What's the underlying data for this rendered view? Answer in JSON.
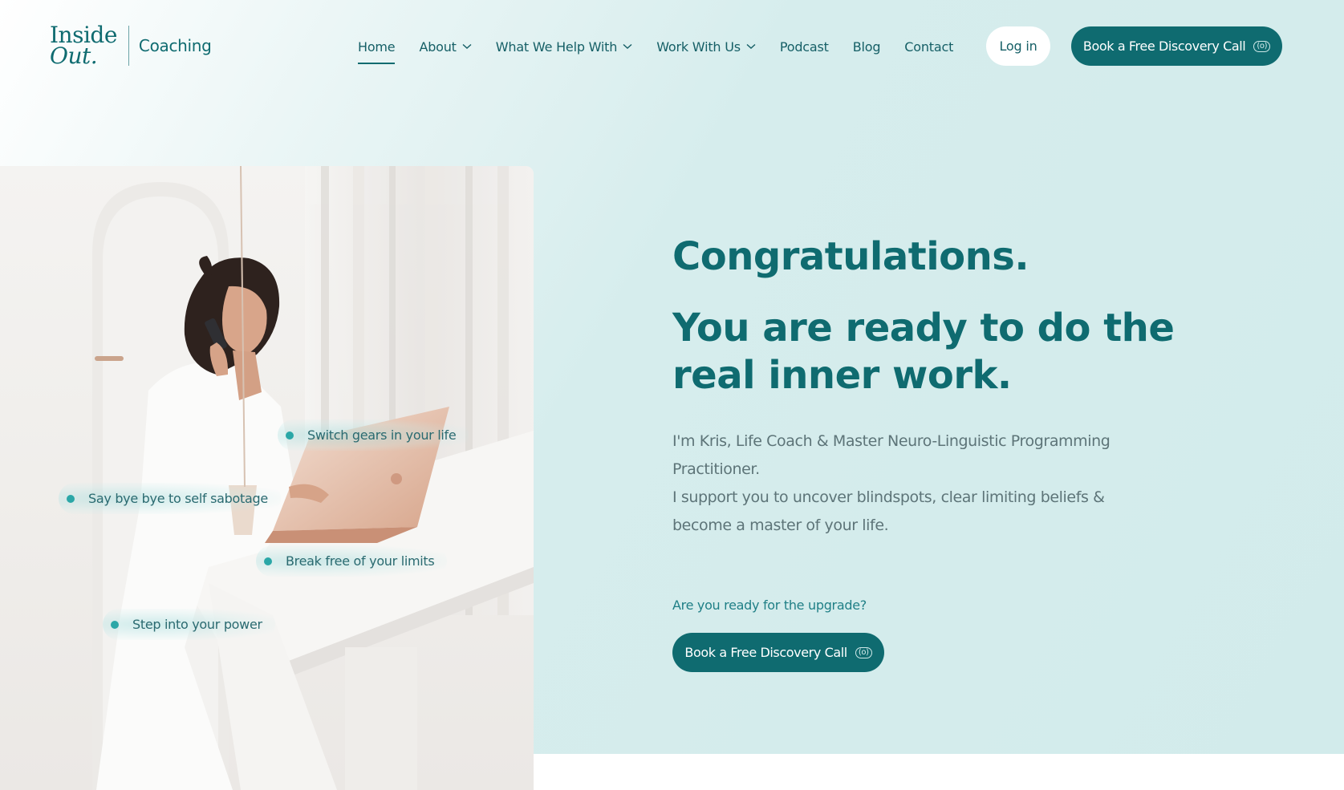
{
  "brand": {
    "logo_line1": "Inside",
    "logo_line2": "Out.",
    "logo_sub": "Coaching"
  },
  "nav": {
    "items": [
      {
        "label": "Home",
        "active": true,
        "dropdown": false
      },
      {
        "label": "About",
        "active": false,
        "dropdown": true
      },
      {
        "label": "What We Help With",
        "active": false,
        "dropdown": true
      },
      {
        "label": "Work With Us",
        "active": false,
        "dropdown": true
      },
      {
        "label": "Podcast",
        "active": false,
        "dropdown": false
      },
      {
        "label": "Blog",
        "active": false,
        "dropdown": false
      },
      {
        "label": "Contact",
        "active": false,
        "dropdown": false
      }
    ],
    "login_label": "Log in",
    "cta_label": "Book a Free Discovery Call"
  },
  "hero": {
    "bullets": [
      "Switch gears in your life",
      "Say bye bye to self sabotage",
      "Break free of your limits",
      "Step into your power"
    ],
    "title_line1": "Congratulations.",
    "title_line2": "You are ready to do the real inner work.",
    "paragraph_lines": [
      "I'm Kris, Life Coach & Master Neuro-Linguistic Programming",
      "Practitioner.",
      "I support you to uncover blindspots, clear limiting beliefs &",
      "become a master of your life."
    ],
    "upgrade_text": "Are you ready for the upgrade?",
    "cta_label": "Book a Free Discovery Call"
  },
  "colors": {
    "brand_teal": "#0f6b70",
    "bullet_dot": "#2ba7a7",
    "hero_bg": "#d2ebeb",
    "body_text": "#5d7478"
  },
  "icons": {
    "cta_icon": "(o)",
    "dropdown": "chevron-down-icon"
  }
}
